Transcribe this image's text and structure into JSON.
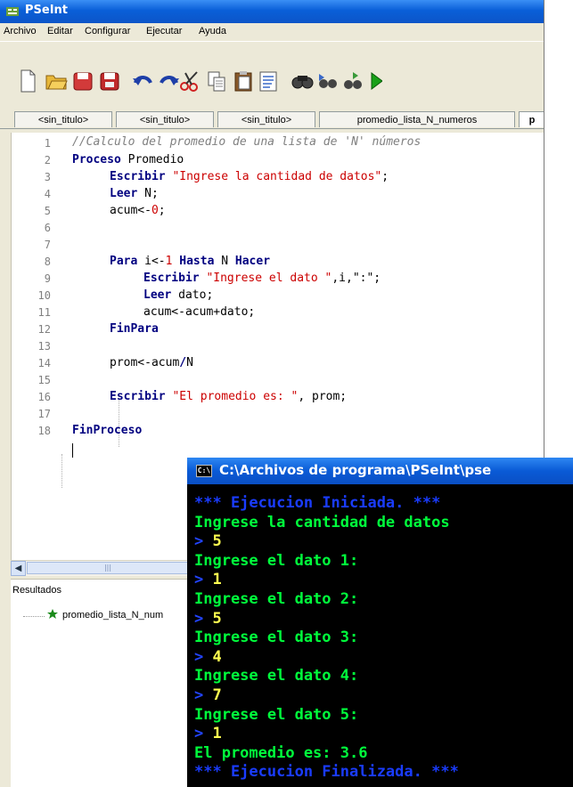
{
  "window": {
    "title": "PSeInt"
  },
  "menu": [
    "Archivo",
    "Editar",
    "Configurar",
    "Ejecutar",
    "Ayuda"
  ],
  "toolbar_icons": [
    "new-file-icon",
    "open-folder-icon",
    "save-icon",
    "save-as-icon",
    "undo-icon",
    "redo-icon",
    "cut-icon",
    "copy-icon",
    "paste-icon",
    "comment-icon",
    "find-icon",
    "find-next-icon",
    "replace-icon",
    "run-icon"
  ],
  "tabs": [
    "<sin_titulo>",
    "<sin_titulo>",
    "<sin_titulo>",
    "promedio_lista_N_numeros",
    "p"
  ],
  "code": {
    "line_numbers": [
      "1",
      "2",
      "3",
      "4",
      "5",
      "6",
      "7",
      "8",
      "9",
      "10",
      "11",
      "12",
      "13",
      "14",
      "15",
      "16",
      "17",
      "18"
    ],
    "l1": "//Calculo del promedio de una lista de 'N' números",
    "l2_kw": "Proceso",
    "l2_rest": " Promedio",
    "l3_kw": "Escribir",
    "l3_str": "\"Ingrese la cantidad de datos\"",
    "l3_end": ";",
    "l4_kw": "Leer",
    "l4_rest": " N;",
    "l5_a": "acum<-",
    "l5_num": "0",
    "l5_end": ";",
    "l7_kw1": "Para",
    "l7_a": " i<-",
    "l7_num": "1",
    "l7_kw2": " Hasta",
    "l7_b": " N ",
    "l7_kw3": "Hacer",
    "l8_kw": "Escribir",
    "l8_str": "\"Ingrese el dato \"",
    "l8_end": ",i,\":\";",
    "l9_kw": "Leer",
    "l9_rest": " dato;",
    "l10": "acum<-acum+dato;",
    "l11_kw": "FinPara",
    "l13_a": "prom<-acum",
    "l13_op": "/",
    "l13_b": "N",
    "l15_kw": "Escribir",
    "l15_str": "\"El promedio es: \"",
    "l15_end": ", prom;",
    "l17_kw": "FinProceso"
  },
  "results": {
    "label": "Resultados",
    "item": "promedio_lista_N_num"
  },
  "console": {
    "title": "C:\\Archivos de programa\\PSeInt\\pse",
    "lines": [
      "*** Ejecucion Iniciada. ***",
      "Ingrese la cantidad de datos",
      "> 5",
      "Ingrese el dato 1:",
      "> 1",
      "Ingrese el dato 2:",
      "> 5",
      "Ingrese el dato 3:",
      "> 4",
      "Ingrese el dato 4:",
      "> 7",
      "Ingrese el dato 5:",
      "> 1",
      "El promedio es: 3.6",
      "*** Ejecucion Finalizada. ***"
    ],
    "inputs": [
      "5",
      "1",
      "5",
      "4",
      "7",
      "1"
    ]
  },
  "colors": {
    "keyword": "#000080",
    "string": "#cc0000",
    "comment": "#808080",
    "console_green": "#00ff3c",
    "console_blue": "#1a3cff",
    "console_yellow": "#ffff50"
  }
}
